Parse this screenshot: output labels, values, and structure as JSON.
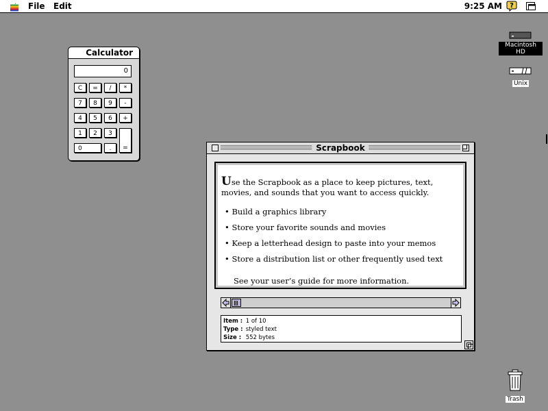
{
  "menubar": {
    "file_label": "File",
    "edit_label": "Edit",
    "clock": "9:25 AM"
  },
  "desktop": {
    "icons": [
      {
        "label": "Macintosh HD",
        "selected": true
      },
      {
        "label": "Unix",
        "selected": false
      },
      {
        "label": "Trash",
        "selected": false
      }
    ]
  },
  "calculator": {
    "title": "Calculator",
    "display": "0",
    "keys": {
      "c": "C",
      "eq_top": "=",
      "div": "/",
      "mul": "*",
      "k7": "7",
      "k8": "8",
      "k9": "9",
      "minus": "-",
      "k4": "4",
      "k5": "5",
      "k6": "6",
      "plus": "+",
      "k1": "1",
      "k2": "2",
      "k3": "3",
      "k0": "0",
      "dot": ".",
      "enter": "="
    }
  },
  "scrapbook": {
    "title": "Scrapbook",
    "intro_first": "U",
    "intro_rest": "se the Scrapbook as a place to keep pictures, text, movies, and sounds that you want to access quickly.",
    "bullets": [
      "• Build a graphics library",
      "• Store your favorite sounds and movies",
      "• Keep a letterhead design to paste into your memos",
      "• Store a distribution list or other frequently used text"
    ],
    "footer": "See your user’s guide for more information.",
    "info": {
      "item_key": "Item :",
      "item_val": "1 of 10",
      "type_key": "Type :",
      "type_val": "styled text",
      "size_key": "Size :",
      "size_val": "552 bytes"
    }
  },
  "colors": {
    "desktop": "#8f8f8f",
    "scroll_thumb": "#b8b0d8"
  }
}
